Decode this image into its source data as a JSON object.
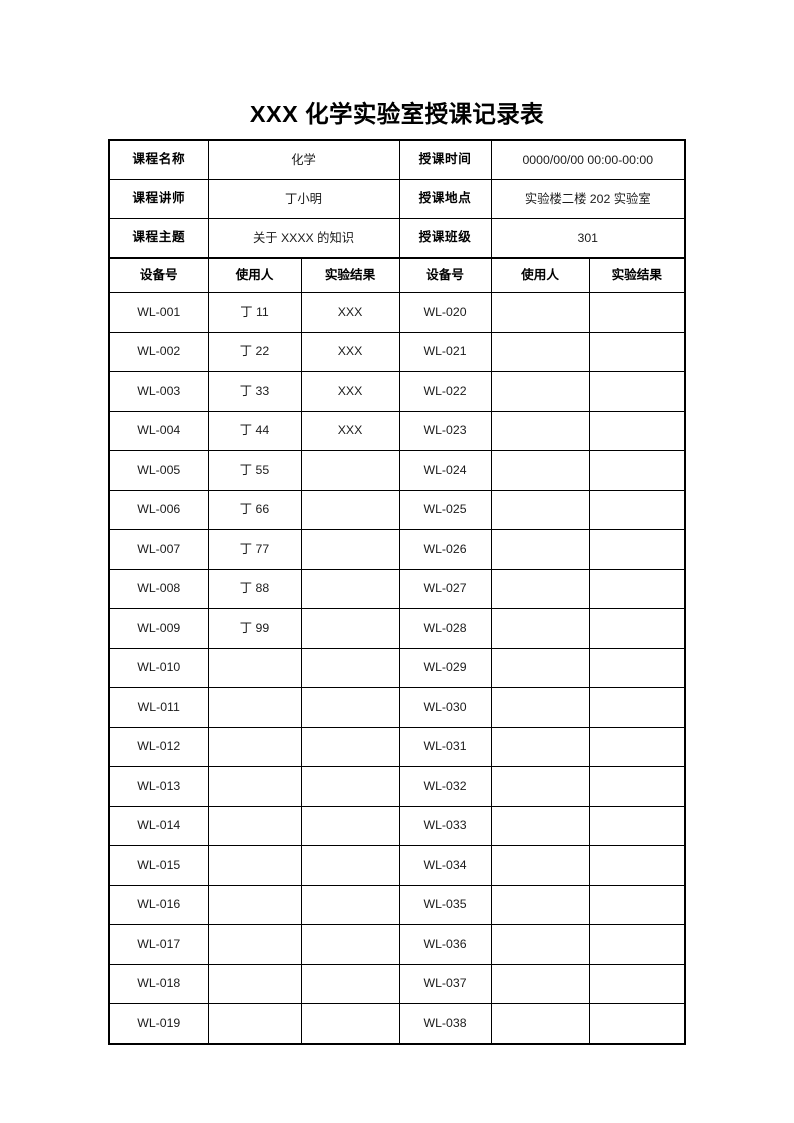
{
  "document": {
    "title": "XXX 化学实验室授课记录表"
  },
  "info": {
    "rows": [
      {
        "label_left": "课程名称",
        "value_left": "化学",
        "label_right": "授课时间",
        "value_right": "0000/00/00   00:00-00:00"
      },
      {
        "label_left": "课程讲师",
        "value_left": "丁小明",
        "label_right": "授课地点",
        "value_right": "实验楼二楼 202 实验室"
      },
      {
        "label_left": "课程主题",
        "value_left": "关于 XXXX 的知识",
        "label_right": "授课班级",
        "value_right": "301"
      }
    ]
  },
  "table": {
    "headers": [
      "设备号",
      "使用人",
      "实验结果",
      "设备号",
      "使用人",
      "实验结果"
    ],
    "rows": [
      {
        "device_left": "WL-001",
        "user_left": "丁 11",
        "result_left": "XXX",
        "device_right": "WL-020",
        "user_right": "",
        "result_right": ""
      },
      {
        "device_left": "WL-002",
        "user_left": "丁 22",
        "result_left": "XXX",
        "device_right": "WL-021",
        "user_right": "",
        "result_right": ""
      },
      {
        "device_left": "WL-003",
        "user_left": "丁 33",
        "result_left": "XXX",
        "device_right": "WL-022",
        "user_right": "",
        "result_right": ""
      },
      {
        "device_left": "WL-004",
        "user_left": "丁 44",
        "result_left": "XXX",
        "device_right": "WL-023",
        "user_right": "",
        "result_right": ""
      },
      {
        "device_left": "WL-005",
        "user_left": "丁 55",
        "result_left": "",
        "device_right": "WL-024",
        "user_right": "",
        "result_right": ""
      },
      {
        "device_left": "WL-006",
        "user_left": "丁 66",
        "result_left": "",
        "device_right": "WL-025",
        "user_right": "",
        "result_right": ""
      },
      {
        "device_left": "WL-007",
        "user_left": "丁 77",
        "result_left": "",
        "device_right": "WL-026",
        "user_right": "",
        "result_right": ""
      },
      {
        "device_left": "WL-008",
        "user_left": "丁 88",
        "result_left": "",
        "device_right": "WL-027",
        "user_right": "",
        "result_right": ""
      },
      {
        "device_left": "WL-009",
        "user_left": "丁 99",
        "result_left": "",
        "device_right": "WL-028",
        "user_right": "",
        "result_right": ""
      },
      {
        "device_left": "WL-010",
        "user_left": "",
        "result_left": "",
        "device_right": "WL-029",
        "user_right": "",
        "result_right": ""
      },
      {
        "device_left": "WL-011",
        "user_left": "",
        "result_left": "",
        "device_right": "WL-030",
        "user_right": "",
        "result_right": ""
      },
      {
        "device_left": "WL-012",
        "user_left": "",
        "result_left": "",
        "device_right": "WL-031",
        "user_right": "",
        "result_right": ""
      },
      {
        "device_left": "WL-013",
        "user_left": "",
        "result_left": "",
        "device_right": "WL-032",
        "user_right": "",
        "result_right": ""
      },
      {
        "device_left": "WL-014",
        "user_left": "",
        "result_left": "",
        "device_right": "WL-033",
        "user_right": "",
        "result_right": ""
      },
      {
        "device_left": "WL-015",
        "user_left": "",
        "result_left": "",
        "device_right": "WL-034",
        "user_right": "",
        "result_right": ""
      },
      {
        "device_left": "WL-016",
        "user_left": "",
        "result_left": "",
        "device_right": "WL-035",
        "user_right": "",
        "result_right": ""
      },
      {
        "device_left": "WL-017",
        "user_left": "",
        "result_left": "",
        "device_right": "WL-036",
        "user_right": "",
        "result_right": ""
      },
      {
        "device_left": "WL-018",
        "user_left": "",
        "result_left": "",
        "device_right": "WL-037",
        "user_right": "",
        "result_right": ""
      },
      {
        "device_left": "WL-019",
        "user_left": "",
        "result_left": "",
        "device_right": "WL-038",
        "user_right": "",
        "result_right": ""
      }
    ]
  }
}
